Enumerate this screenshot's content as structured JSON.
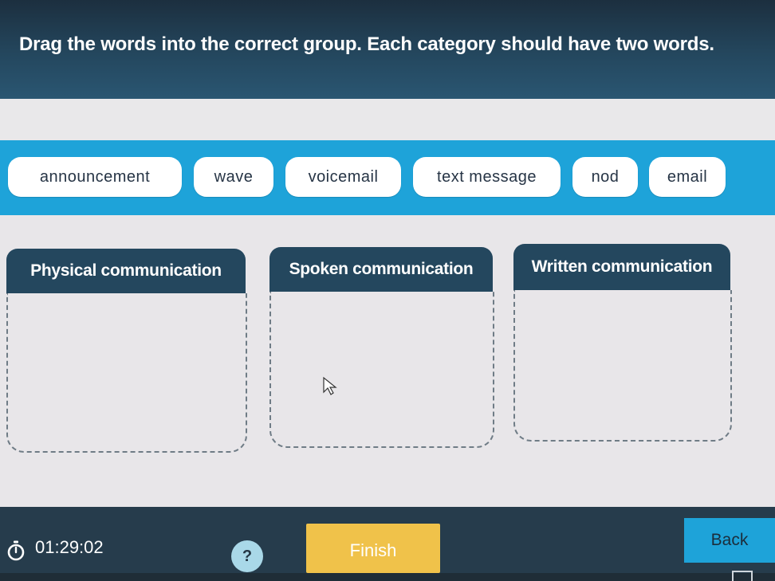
{
  "instruction": "Drag the words into the correct group. Each category should have two words.",
  "words": [
    "announcement",
    "wave",
    "voicemail",
    "text message",
    "nod",
    "email"
  ],
  "categories": [
    "Physical communication",
    "Spoken communication",
    "Written communication"
  ],
  "footer": {
    "timer": "01:29:02",
    "help_label": "?",
    "finish_label": "Finish",
    "back_label": "Back"
  },
  "colors": {
    "header": "#24475e",
    "word_bank": "#1ea3d9",
    "finish": "#f0c24a",
    "back": "#1ea3d9"
  },
  "icons": [
    "stopwatch-icon",
    "cursor-icon"
  ]
}
